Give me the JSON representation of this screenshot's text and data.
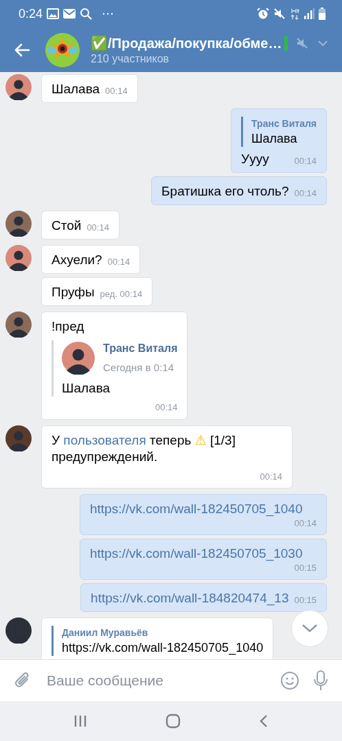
{
  "status_bar": {
    "time": "0:24",
    "more": "⋯"
  },
  "header": {
    "title": "✅/Продажа/покупка/обме…",
    "subtitle": "210 участников"
  },
  "messages": [
    {
      "outgoing": false,
      "avatar": {
        "color": "#d98a7a"
      },
      "kind": "text",
      "text": "Шалава",
      "time": "00:14"
    },
    {
      "outgoing": true,
      "kind": "text",
      "reply": {
        "author": "Транс Виталя",
        "text": "Шалава"
      },
      "text": "Уууу",
      "time": "00:14"
    },
    {
      "outgoing": true,
      "kind": "text",
      "text": "Братишка его чтоль?",
      "time": "00:14"
    },
    {
      "outgoing": false,
      "avatar": {
        "color": "#8a6a58"
      },
      "kind": "text",
      "text": "Стой",
      "time": "00:14"
    },
    {
      "outgoing": false,
      "avatar": {
        "color": "#d98a7a"
      },
      "kind": "text",
      "text": "Ахуели?",
      "time": "00:14"
    },
    {
      "outgoing": false,
      "kind": "text",
      "text": "Пруфы",
      "edited": "ред.",
      "time": "00:14"
    },
    {
      "outgoing": false,
      "avatar": {
        "color": "#8a6a58"
      },
      "kind": "text",
      "text": "!пред",
      "forward": {
        "avatar": {
          "color": "#d98a7a"
        },
        "author": "Транс Виталя",
        "date": "Сегодня в 0:14",
        "text": "Шалава"
      },
      "time": "00:14"
    },
    {
      "outgoing": false,
      "avatar": {
        "color": "#5a3a2a"
      },
      "kind": "rich",
      "parts": [
        {
          "kind": "plain",
          "text": "У "
        },
        {
          "kind": "link",
          "text": "пользователя"
        },
        {
          "kind": "plain",
          "text": " теперь "
        },
        {
          "kind": "emoji",
          "text": "⚠"
        },
        {
          "kind": "plain",
          "text": " [1/3] предупреждений."
        }
      ],
      "time": "00:14"
    },
    {
      "outgoing": true,
      "kind": "link",
      "text": "https://vk.com/wall-182450705_1040",
      "time": "00:14"
    },
    {
      "outgoing": true,
      "kind": "link",
      "text": "https://vk.com/wall-182450705_1030",
      "time": "00:15"
    },
    {
      "outgoing": true,
      "kind": "link",
      "text": "https://vk.com/wall-184820474_13",
      "time": "00:15"
    },
    {
      "outgoing": false,
      "avatar": {
        "color": "#2c3038"
      },
      "kind": "text",
      "reply": {
        "author": "Даниил Муравьёв",
        "text": "https://vk.com/wall-182450705_1040"
      }
    }
  ],
  "composer": {
    "placeholder": "Ваше сообщение"
  }
}
